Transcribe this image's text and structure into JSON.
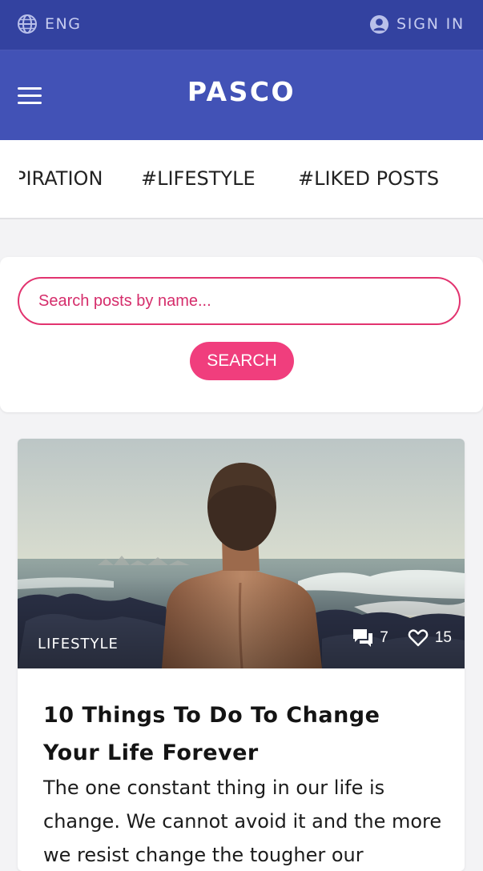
{
  "topbar": {
    "language": "ENG",
    "sign_in": "SIGN IN",
    "colors": {
      "background": "#3342a0",
      "text": "#c7cdf0"
    }
  },
  "header": {
    "logo": "PASCO",
    "background": "#4252b6"
  },
  "tags": [
    {
      "label": "PIRATION"
    },
    {
      "label": "#LIFESTYLE"
    },
    {
      "label": "#LIKED POSTS"
    }
  ],
  "search": {
    "placeholder": "Search posts by name...",
    "button": "SEARCH",
    "accent": "#f03e7d"
  },
  "post": {
    "category": "LIFESTYLE",
    "comments": "7",
    "likes": "15",
    "title": "10 Things To Do To Change Your Life Forever",
    "excerpt": "The one constant thing in our life is change. We cannot avoid it and the more we resist change the tougher our",
    "icons": {
      "comments": "comments-icon",
      "likes": "heart-icon"
    }
  }
}
